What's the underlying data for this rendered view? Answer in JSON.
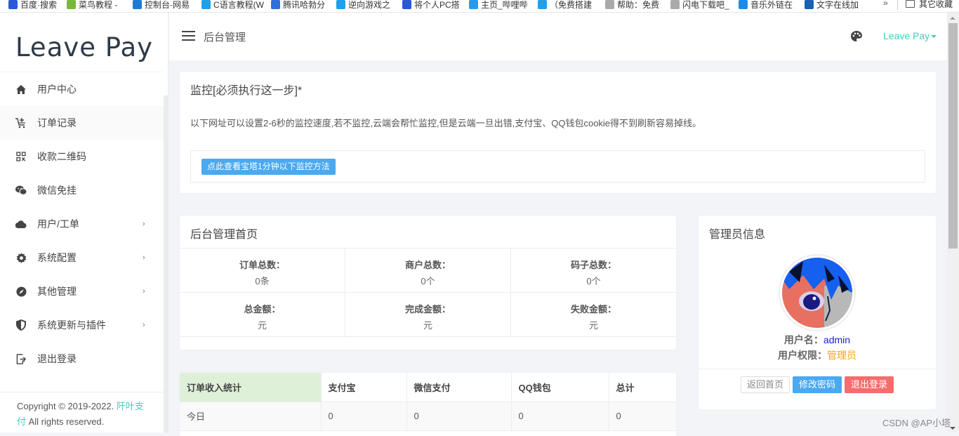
{
  "browser": {
    "bookmarks": [
      {
        "label": "百度·搜索",
        "icon": "baidu-icon",
        "color": "#2b58d6"
      },
      {
        "label": "菜鸟教程 -",
        "icon": "runoob-icon",
        "color": "#78b83c"
      },
      {
        "label": "控制台-网易",
        "icon": "edge-icon",
        "color": "#1f7ad6"
      },
      {
        "label": "C语言教程(W",
        "icon": "bilibili-icon",
        "color": "#20a0e8"
      },
      {
        "label": "腾讯哈勃分",
        "icon": "tencent-icon",
        "color": "#2e6fd8"
      },
      {
        "label": "逆向游戏之",
        "icon": "bilibili-icon",
        "color": "#20a0e8"
      },
      {
        "label": "将个人PC搭",
        "icon": "baidu-icon",
        "color": "#2b58d6"
      },
      {
        "label": "主页_哔哩哔",
        "icon": "bilibili-icon",
        "color": "#20a0e8"
      },
      {
        "label": "（免费搭建",
        "icon": "bilibili-icon",
        "color": "#20a0e8"
      },
      {
        "label": "帮助：免费",
        "icon": "page-icon",
        "color": "#aaaaaa"
      },
      {
        "label": "闪电下载吧_",
        "icon": "page-icon",
        "color": "#aaaaaa"
      },
      {
        "label": "音乐外链在",
        "icon": "music-icon",
        "color": "#1f8ae6"
      },
      {
        "label": "文字在线加",
        "icon": "text-icon",
        "color": "#1a5fb4"
      }
    ],
    "more": "»",
    "other_bookmarks": "其它收藏"
  },
  "sidebar": {
    "logo": "Leave Pay",
    "items": [
      {
        "label": "用户中心",
        "icon": "home-icon",
        "has_submenu": false
      },
      {
        "label": "订单记录",
        "icon": "cart-icon",
        "has_submenu": false
      },
      {
        "label": "收款二维码",
        "icon": "qrcode-icon",
        "has_submenu": false
      },
      {
        "label": "微信免挂",
        "icon": "wechat-icon",
        "has_submenu": false
      },
      {
        "label": "用户/工单",
        "icon": "cloud-icon",
        "has_submenu": true
      },
      {
        "label": "系统配置",
        "icon": "gear-icon",
        "has_submenu": true
      },
      {
        "label": "其他管理",
        "icon": "compass-icon",
        "has_submenu": true
      },
      {
        "label": "系统更新与插件",
        "icon": "shield-icon",
        "has_submenu": true
      },
      {
        "label": "退出登录",
        "icon": "logout-icon",
        "has_submenu": false
      }
    ],
    "chevron": "›",
    "footer": {
      "copyright_prefix": "Copyright © 2019-2022. ",
      "brand": "阡叶支",
      "line2_brand": "付",
      "line2_text": " All rights reserved."
    }
  },
  "header": {
    "title": "后台管理",
    "user_menu": "Leave Pay"
  },
  "monitor": {
    "title": "监控[必须执行这一步]*",
    "description": "以下网址可以设置2-6秒的监控速度,若不监控,云端会帮忙监控,但是云端一旦出错,支付宝、QQ钱包cookie得不到刷新容易掉线。",
    "button": "点此查看宝塔1分钟以下监控方法"
  },
  "dashboard": {
    "title": "后台管理首页",
    "stats": [
      [
        {
          "label": "订单总数：",
          "value": "0条"
        },
        {
          "label": "商户总数：",
          "value": "0个"
        },
        {
          "label": "码子总数：",
          "value": "0个"
        }
      ],
      [
        {
          "label": "总金额：",
          "value": "元"
        },
        {
          "label": "完成金额：",
          "value": "元"
        },
        {
          "label": "失败金额：",
          "value": "元"
        }
      ]
    ]
  },
  "income": {
    "headers": [
      "订单收入统计",
      "支付宝",
      "微信支付",
      "QQ钱包",
      "总计"
    ],
    "rows": [
      [
        "今日",
        "0",
        "0",
        "0",
        "0"
      ]
    ]
  },
  "admin": {
    "title": "管理员信息",
    "username_label": "用户名：",
    "username": "admin",
    "role_label": "用户权限：",
    "role": "管理员",
    "buttons": {
      "home": "返回首页",
      "change_password": "修改密码",
      "logout": "退出登录"
    }
  },
  "watermark": "CSDN @AP小塔",
  "colors": {
    "accent": "#3fcdbb",
    "info_button": "#4aa9f0",
    "danger_button": "#f76c6c",
    "username": "#1a1adb",
    "role": "#f7a51c",
    "income_header_highlight": "#dff0d8"
  }
}
